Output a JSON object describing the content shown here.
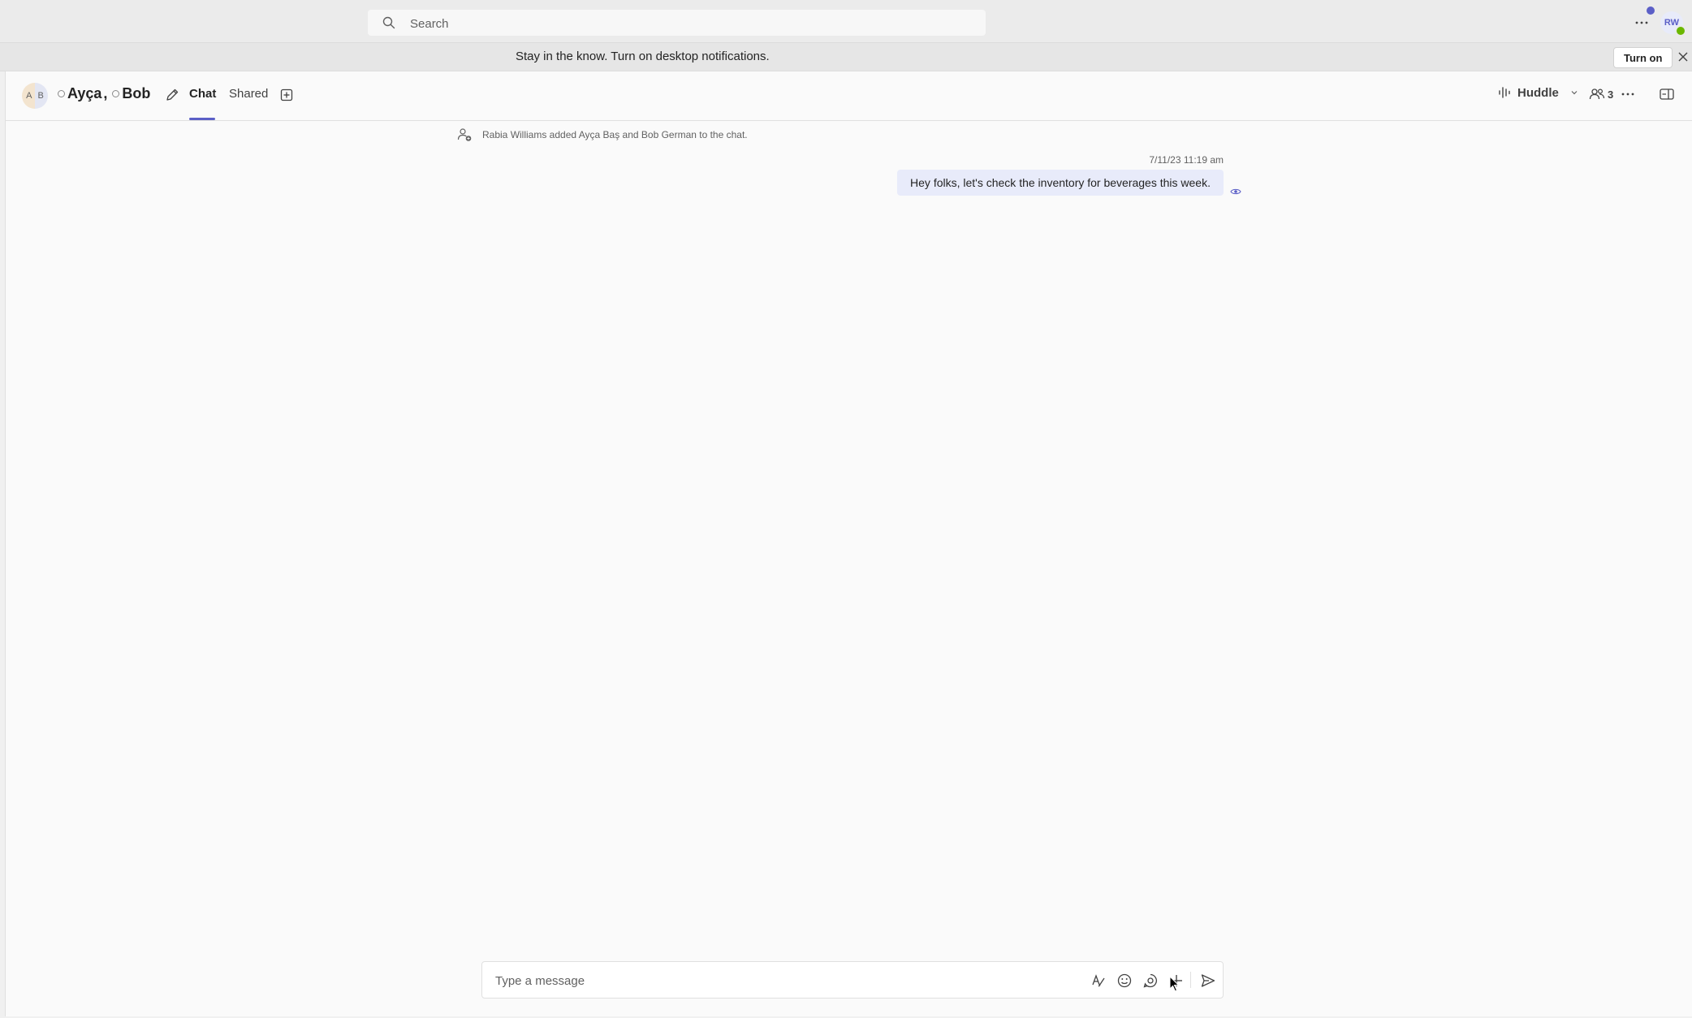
{
  "titlebar": {
    "search_placeholder": "Search",
    "more_icon": "more-horizontal-icon",
    "user_initials": "RW",
    "presence_color": "#6bb700",
    "notification_dot_color": "#5b5fc7"
  },
  "banner": {
    "text": "Stay in the know. Turn on desktop notifications.",
    "turn_on_label": "Turn on",
    "close_icon": "close-icon"
  },
  "chat": {
    "avatar_initials": [
      "A",
      "B"
    ],
    "title_name_1": "Ayça",
    "title_separator": ",",
    "title_name_2": "Bob",
    "tabs": [
      {
        "label": "Chat",
        "active": true
      },
      {
        "label": "Shared",
        "active": false
      }
    ],
    "accent_color": "#5b5fc7",
    "huddle_label": "Huddle",
    "participant_count": "3",
    "system_message": "Rabia Williams added Ayça Baş and Bob German to the chat.",
    "messages": [
      {
        "timestamp": "7/11/23 11:19 am",
        "text": "Hey folks, let's check the inventory for beverages this week.",
        "bubble_color": "#e8ebfa"
      }
    ]
  },
  "composer": {
    "placeholder": "Type a message",
    "icons": [
      "format-icon",
      "emoji-icon",
      "loop-icon",
      "plus-icon",
      "send-icon"
    ]
  }
}
